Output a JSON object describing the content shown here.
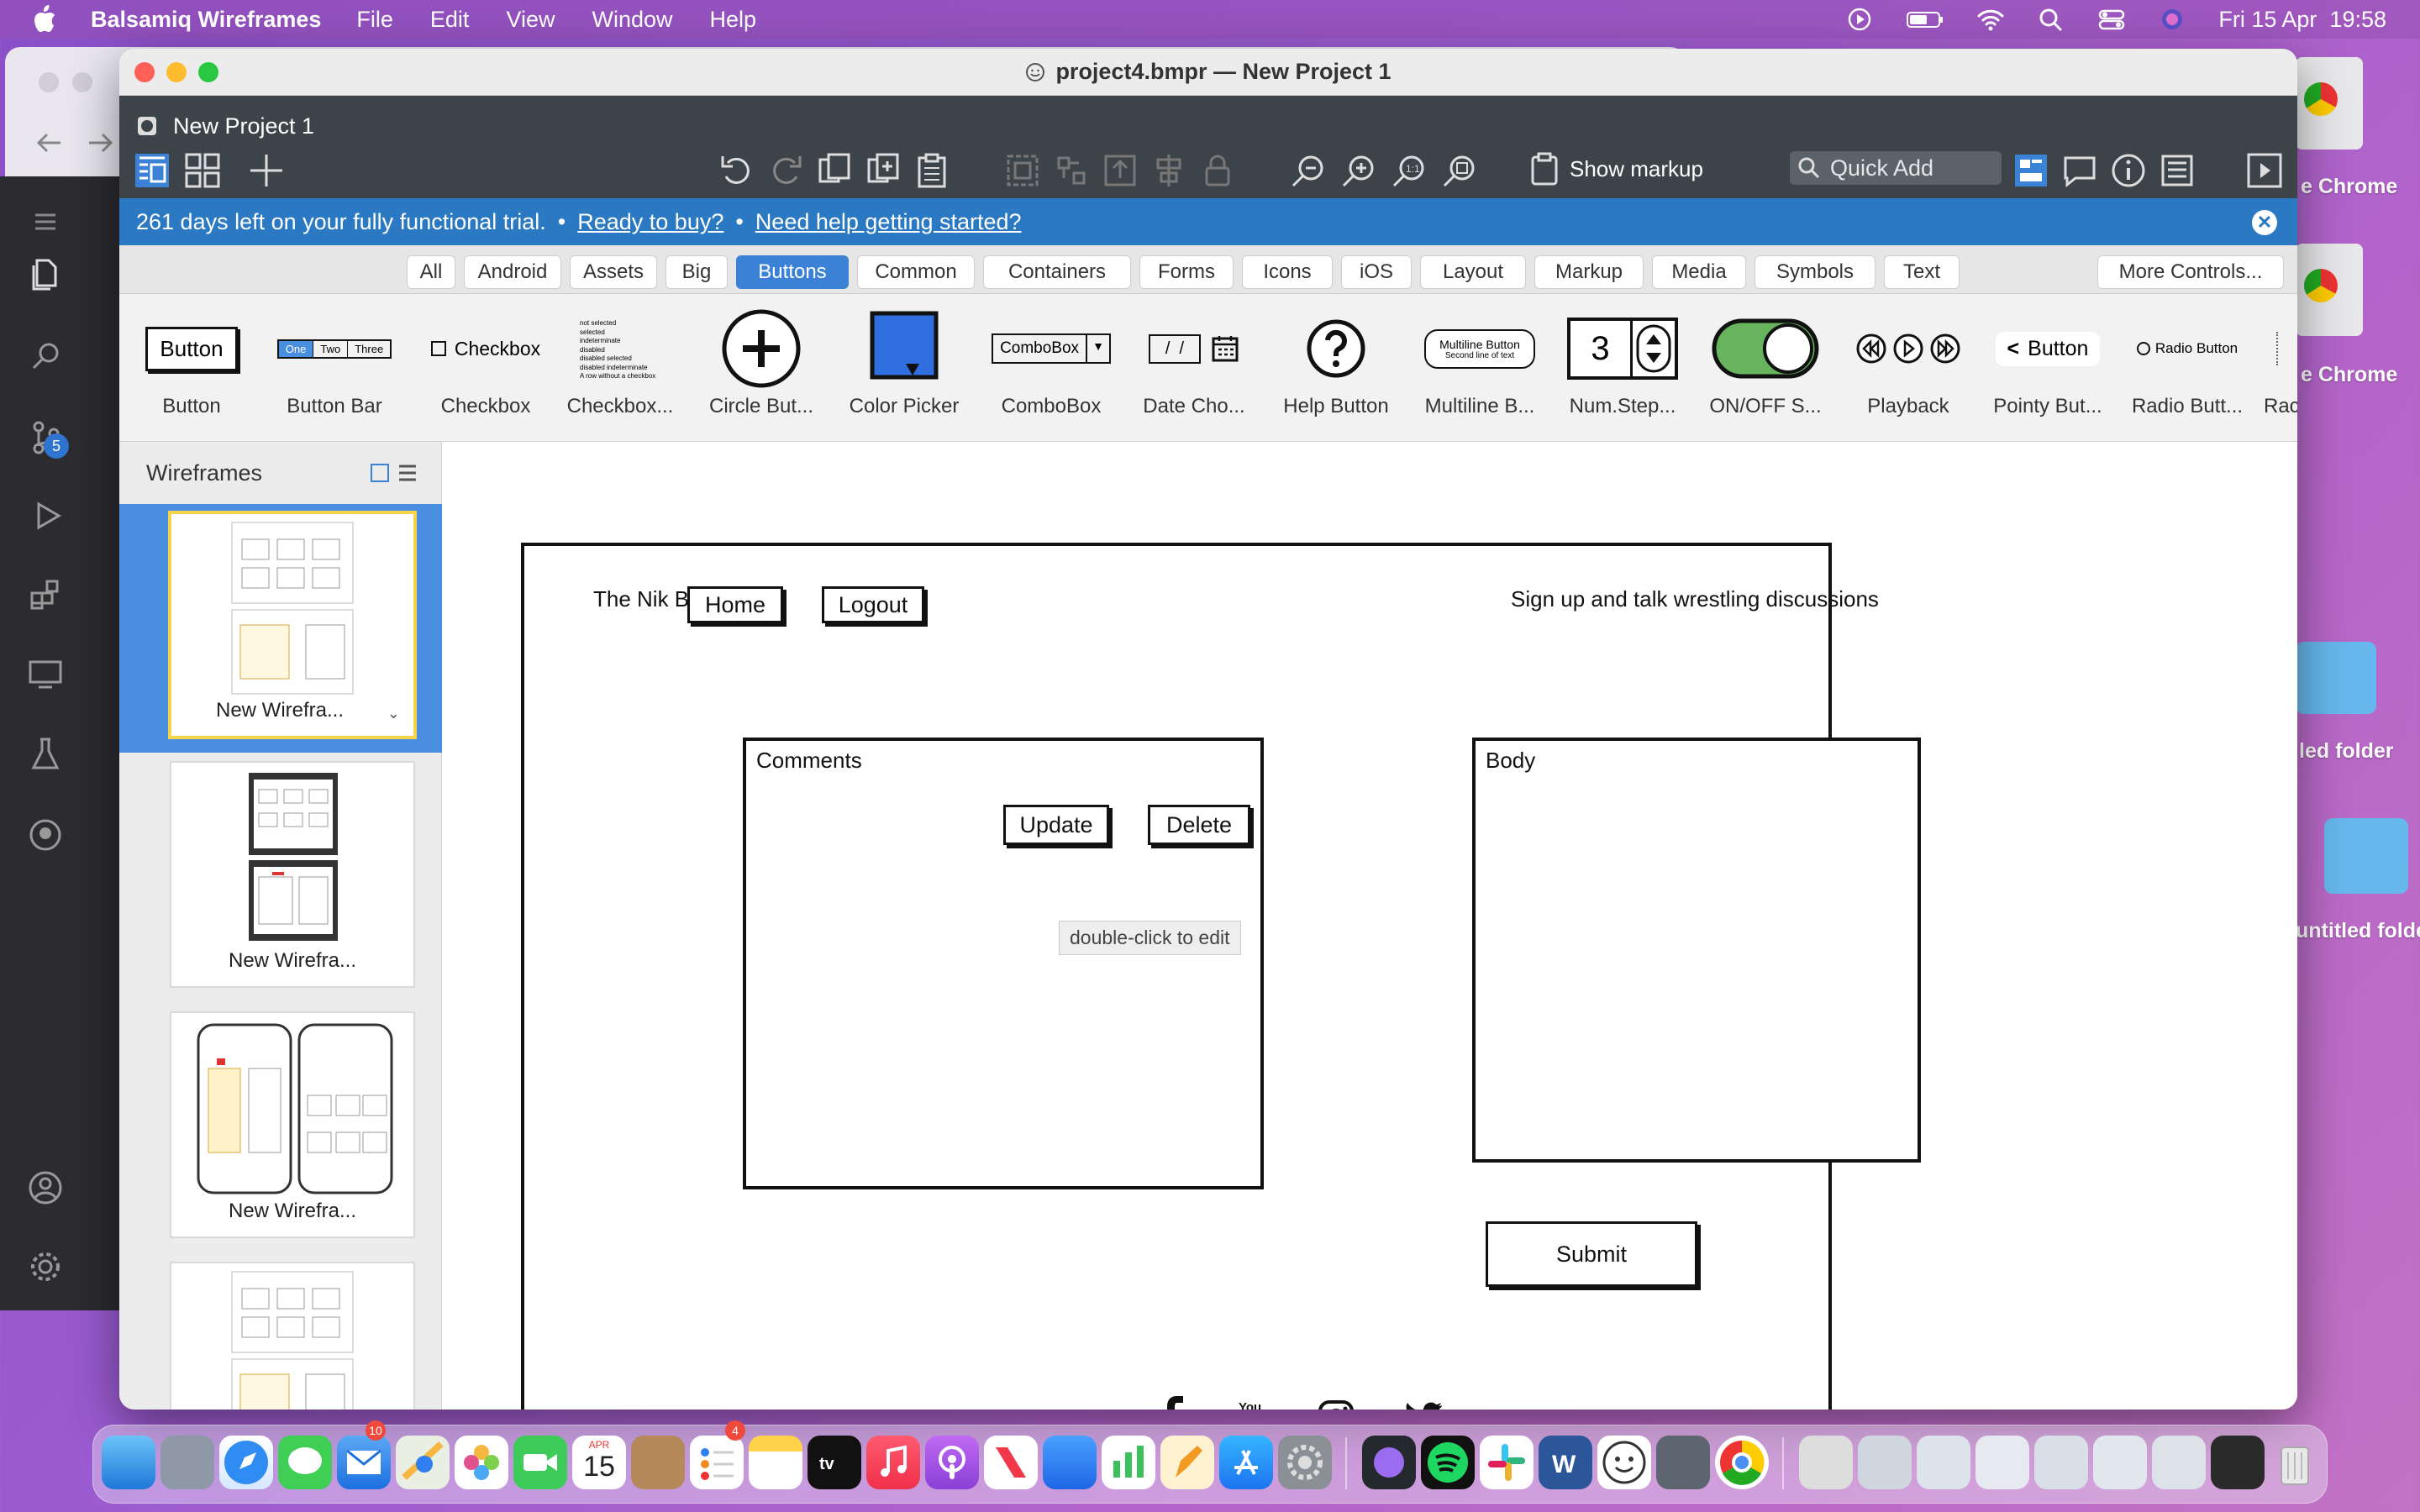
{
  "menubar": {
    "app_name": "Balsamiq Wireframes",
    "items": [
      "File",
      "Edit",
      "View",
      "Window",
      "Help"
    ],
    "clock": "Fri 15 Apr  19:58"
  },
  "window": {
    "title": "project4.bmpr — New Project 1",
    "project_title": "New Project 1"
  },
  "toolbar": {
    "show_markup": "Show markup",
    "quick_add_placeholder": "Quick Add"
  },
  "trial": {
    "message": "261 days left on your fully functional trial.",
    "sep": "•",
    "buy_link": "Ready to buy?",
    "help_link": "Need help getting started?"
  },
  "categories": {
    "tabs": [
      "All",
      "Android",
      "Assets",
      "Big",
      "Buttons",
      "Common",
      "Containers",
      "Forms",
      "Icons",
      "iOS",
      "Layout",
      "Markup",
      "Media",
      "Symbols",
      "Text"
    ],
    "active": "Buttons",
    "more": "More Controls..."
  },
  "library": {
    "items": [
      "Button",
      "Button Bar",
      "Checkbox",
      "Checkbox...",
      "Circle But...",
      "Color Picker",
      "ComboBox",
      "Date Cho...",
      "Help Button",
      "Multiline B...",
      "Num.Step...",
      "ON/OFF S...",
      "Playback",
      "Pointy But...",
      "Radio Butt...",
      "Rac"
    ],
    "button_text": "Button",
    "bar_segments": [
      "One",
      "Two",
      "Three"
    ],
    "checkbox_text": "Checkbox",
    "checkbox_list": [
      "not selected",
      "selected",
      "indeterminate",
      "disabled",
      "disabled selected",
      "disabled indeterminate",
      "A row without a checkbox"
    ],
    "combo_text": "ComboBox",
    "date_text": "/  /",
    "multiline_line1": "Multiline Button",
    "multiline_line2": "Second line of text",
    "stepper_value": "3",
    "pointy_text": "Button",
    "radio_text": "Radio Button"
  },
  "sidebar": {
    "title": "Wireframes",
    "thumbs": [
      "New Wirefra...",
      "New Wirefra...",
      "New Wirefra..."
    ]
  },
  "wireframe": {
    "site_title": "The Nik Blog",
    "home": "Home",
    "logout": "Logout",
    "tagline": "Sign up and talk wrestling discussions",
    "comments_label": "Comments",
    "update": "Update",
    "delete": "Delete",
    "tooltip": "double-click to edit",
    "body_label": "Body",
    "submit": "Submit"
  },
  "desktop": {
    "items": [
      "e Chrome",
      "e Chrome",
      "led folder",
      "untitled folde"
    ]
  },
  "vscode": {
    "badge": "5"
  },
  "dock": {
    "mail_badge": "10",
    "reminders_badge": "4",
    "calendar_month": "APR",
    "calendar_day": "15"
  },
  "colors": {
    "accent": "#3b82d6",
    "trial_bar": "#2a79c2",
    "toolbar": "#3d4449"
  }
}
